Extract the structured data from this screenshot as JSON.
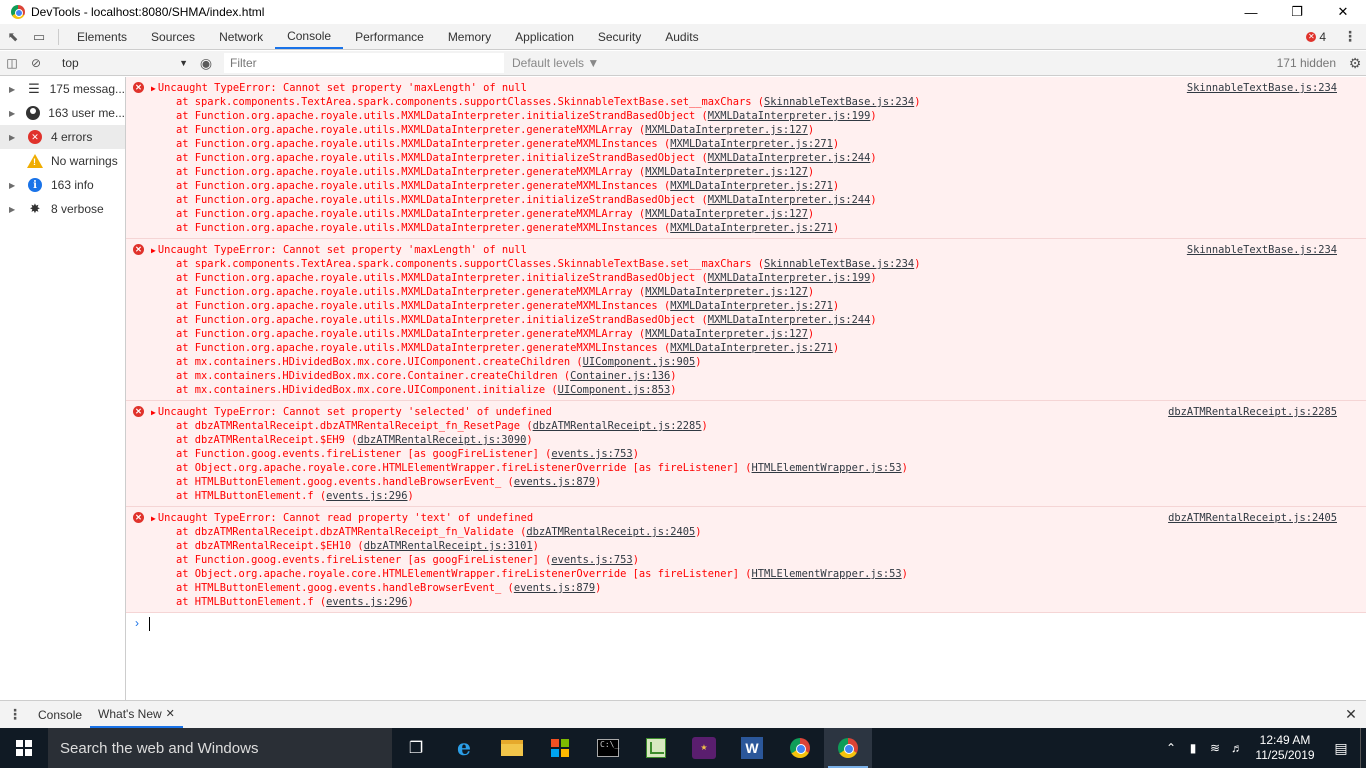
{
  "window": {
    "title": "DevTools - localhost:8080/SHMA/index.html"
  },
  "devtools_tabs": [
    {
      "label": "Elements",
      "active": false
    },
    {
      "label": "Sources",
      "active": false
    },
    {
      "label": "Network",
      "active": false
    },
    {
      "label": "Console",
      "active": true
    },
    {
      "label": "Performance",
      "active": false
    },
    {
      "label": "Memory",
      "active": false
    },
    {
      "label": "Application",
      "active": false
    },
    {
      "label": "Security",
      "active": false
    },
    {
      "label": "Audits",
      "active": false
    }
  ],
  "error_badge": "4",
  "toolbar": {
    "context": "top",
    "filter_placeholder": "Filter",
    "levels": "Default levels ▼",
    "hidden": "171 hidden"
  },
  "sidebar": [
    {
      "label": "175 messag...",
      "icon": "list-icon"
    },
    {
      "label": "163 user me...",
      "icon": "user-icon"
    },
    {
      "label": "4 errors",
      "icon": "error-icon"
    },
    {
      "label": "No warnings",
      "icon": "warning-icon"
    },
    {
      "label": "163 info",
      "icon": "info-icon"
    },
    {
      "label": "8 verbose",
      "icon": "bug-icon"
    }
  ],
  "messages": [
    {
      "text": "Uncaught TypeError: Cannot set property 'maxLength' of null",
      "source": "SkinnableTextBase.js:234",
      "frames": [
        {
          "at": "at spark.components.TextArea.spark.components.supportClasses.SkinnableTextBase.set__maxChars",
          "file": "SkinnableTextBase.js:234"
        },
        {
          "at": "at Function.org.apache.royale.utils.MXMLDataInterpreter.initializeStrandBasedObject",
          "file": "MXMLDataInterpreter.js:199"
        },
        {
          "at": "at Function.org.apache.royale.utils.MXMLDataInterpreter.generateMXMLArray",
          "file": "MXMLDataInterpreter.js:127"
        },
        {
          "at": "at Function.org.apache.royale.utils.MXMLDataInterpreter.generateMXMLInstances",
          "file": "MXMLDataInterpreter.js:271"
        },
        {
          "at": "at Function.org.apache.royale.utils.MXMLDataInterpreter.initializeStrandBasedObject",
          "file": "MXMLDataInterpreter.js:244"
        },
        {
          "at": "at Function.org.apache.royale.utils.MXMLDataInterpreter.generateMXMLArray",
          "file": "MXMLDataInterpreter.js:127"
        },
        {
          "at": "at Function.org.apache.royale.utils.MXMLDataInterpreter.generateMXMLInstances",
          "file": "MXMLDataInterpreter.js:271"
        },
        {
          "at": "at Function.org.apache.royale.utils.MXMLDataInterpreter.initializeStrandBasedObject",
          "file": "MXMLDataInterpreter.js:244"
        },
        {
          "at": "at Function.org.apache.royale.utils.MXMLDataInterpreter.generateMXMLArray",
          "file": "MXMLDataInterpreter.js:127"
        },
        {
          "at": "at Function.org.apache.royale.utils.MXMLDataInterpreter.generateMXMLInstances",
          "file": "MXMLDataInterpreter.js:271"
        }
      ]
    },
    {
      "text": "Uncaught TypeError: Cannot set property 'maxLength' of null",
      "source": "SkinnableTextBase.js:234",
      "frames": [
        {
          "at": "at spark.components.TextArea.spark.components.supportClasses.SkinnableTextBase.set__maxChars",
          "file": "SkinnableTextBase.js:234"
        },
        {
          "at": "at Function.org.apache.royale.utils.MXMLDataInterpreter.initializeStrandBasedObject",
          "file": "MXMLDataInterpreter.js:199"
        },
        {
          "at": "at Function.org.apache.royale.utils.MXMLDataInterpreter.generateMXMLArray",
          "file": "MXMLDataInterpreter.js:127"
        },
        {
          "at": "at Function.org.apache.royale.utils.MXMLDataInterpreter.generateMXMLInstances",
          "file": "MXMLDataInterpreter.js:271"
        },
        {
          "at": "at Function.org.apache.royale.utils.MXMLDataInterpreter.initializeStrandBasedObject",
          "file": "MXMLDataInterpreter.js:244"
        },
        {
          "at": "at Function.org.apache.royale.utils.MXMLDataInterpreter.generateMXMLArray",
          "file": "MXMLDataInterpreter.js:127"
        },
        {
          "at": "at Function.org.apache.royale.utils.MXMLDataInterpreter.generateMXMLInstances",
          "file": "MXMLDataInterpreter.js:271"
        },
        {
          "at": "at mx.containers.HDividedBox.mx.core.UIComponent.createChildren",
          "file": "UIComponent.js:905"
        },
        {
          "at": "at mx.containers.HDividedBox.mx.core.Container.createChildren",
          "file": "Container.js:136"
        },
        {
          "at": "at mx.containers.HDividedBox.mx.core.UIComponent.initialize",
          "file": "UIComponent.js:853"
        }
      ]
    },
    {
      "text": "Uncaught TypeError: Cannot set property 'selected' of undefined",
      "source": "dbzATMRentalReceipt.js:2285",
      "frames": [
        {
          "at": "at dbzATMRentalReceipt.dbzATMRentalReceipt_fn_ResetPage",
          "file": "dbzATMRentalReceipt.js:2285"
        },
        {
          "at": "at dbzATMRentalReceipt.$EH9",
          "file": "dbzATMRentalReceipt.js:3090"
        },
        {
          "at": "at Function.goog.events.fireListener [as googFireListener]",
          "file": "events.js:753"
        },
        {
          "at": "at Object.org.apache.royale.core.HTMLElementWrapper.fireListenerOverride [as fireListener]",
          "file": "HTMLElementWrapper.js:53"
        },
        {
          "at": "at HTMLButtonElement.goog.events.handleBrowserEvent_",
          "file": "events.js:879"
        },
        {
          "at": "at HTMLButtonElement.f",
          "file": "events.js:296"
        }
      ]
    },
    {
      "text": "Uncaught TypeError: Cannot read property 'text' of undefined",
      "source": "dbzATMRentalReceipt.js:2405",
      "frames": [
        {
          "at": "at dbzATMRentalReceipt.dbzATMRentalReceipt_fn_Validate",
          "file": "dbzATMRentalReceipt.js:2405"
        },
        {
          "at": "at dbzATMRentalReceipt.$EH10",
          "file": "dbzATMRentalReceipt.js:3101"
        },
        {
          "at": "at Function.goog.events.fireListener [as googFireListener]",
          "file": "events.js:753"
        },
        {
          "at": "at Object.org.apache.royale.core.HTMLElementWrapper.fireListenerOverride [as fireListener]",
          "file": "HTMLElementWrapper.js:53"
        },
        {
          "at": "at HTMLButtonElement.goog.events.handleBrowserEvent_",
          "file": "events.js:879"
        },
        {
          "at": "at HTMLButtonElement.f",
          "file": "events.js:296"
        }
      ]
    }
  ],
  "drawer_tabs": [
    {
      "label": "Console",
      "active": false
    },
    {
      "label": "What's New",
      "active": true
    }
  ],
  "taskbar": {
    "search_placeholder": "Search the web and Windows",
    "time": "12:49 AM",
    "date": "11/25/2019"
  },
  "colors": {
    "accent": "#1a73e8",
    "error_text": "#ff0000",
    "error_bg": "#fff0f0",
    "taskbar": "#101a24"
  }
}
